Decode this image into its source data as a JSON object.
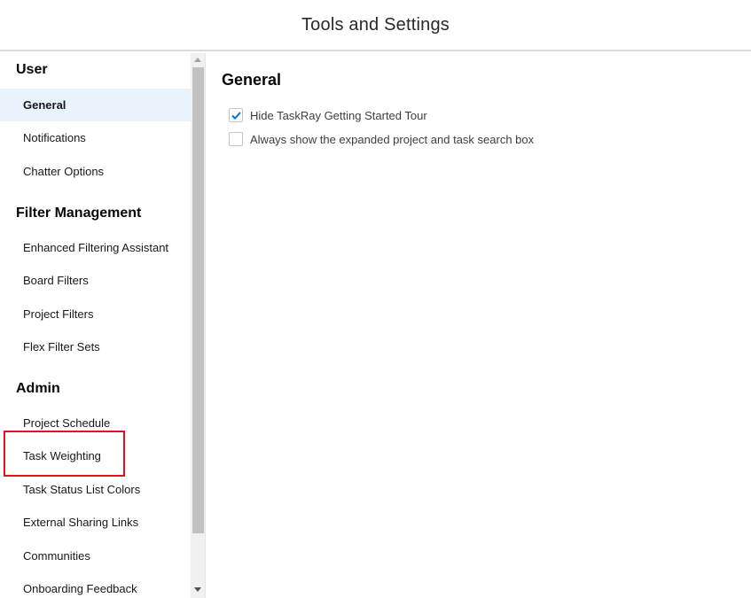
{
  "header": {
    "title": "Tools and Settings"
  },
  "sidebar": {
    "sections": [
      {
        "heading": "User",
        "items": [
          "General",
          "Notifications",
          "Chatter Options"
        ]
      },
      {
        "heading": "Filter Management",
        "items": [
          "Enhanced Filtering Assistant",
          "Board Filters",
          "Project Filters",
          "Flex Filter Sets"
        ]
      },
      {
        "heading": "Admin",
        "items": [
          "Project Schedule",
          "Task Weighting",
          "Task Status List Colors",
          "External Sharing Links",
          "Communities",
          "Onboarding Feedback"
        ]
      }
    ],
    "active_item": "General",
    "highlighted_item": "Task Weighting"
  },
  "main": {
    "title": "General",
    "options": [
      {
        "label": "Hide TaskRay Getting Started Tour",
        "checked": true
      },
      {
        "label": "Always show the expanded project and task search box",
        "checked": false
      }
    ]
  },
  "colors": {
    "accent": "#0176d3",
    "active_bg": "#e8f3fc",
    "highlight": "#e0141e"
  }
}
